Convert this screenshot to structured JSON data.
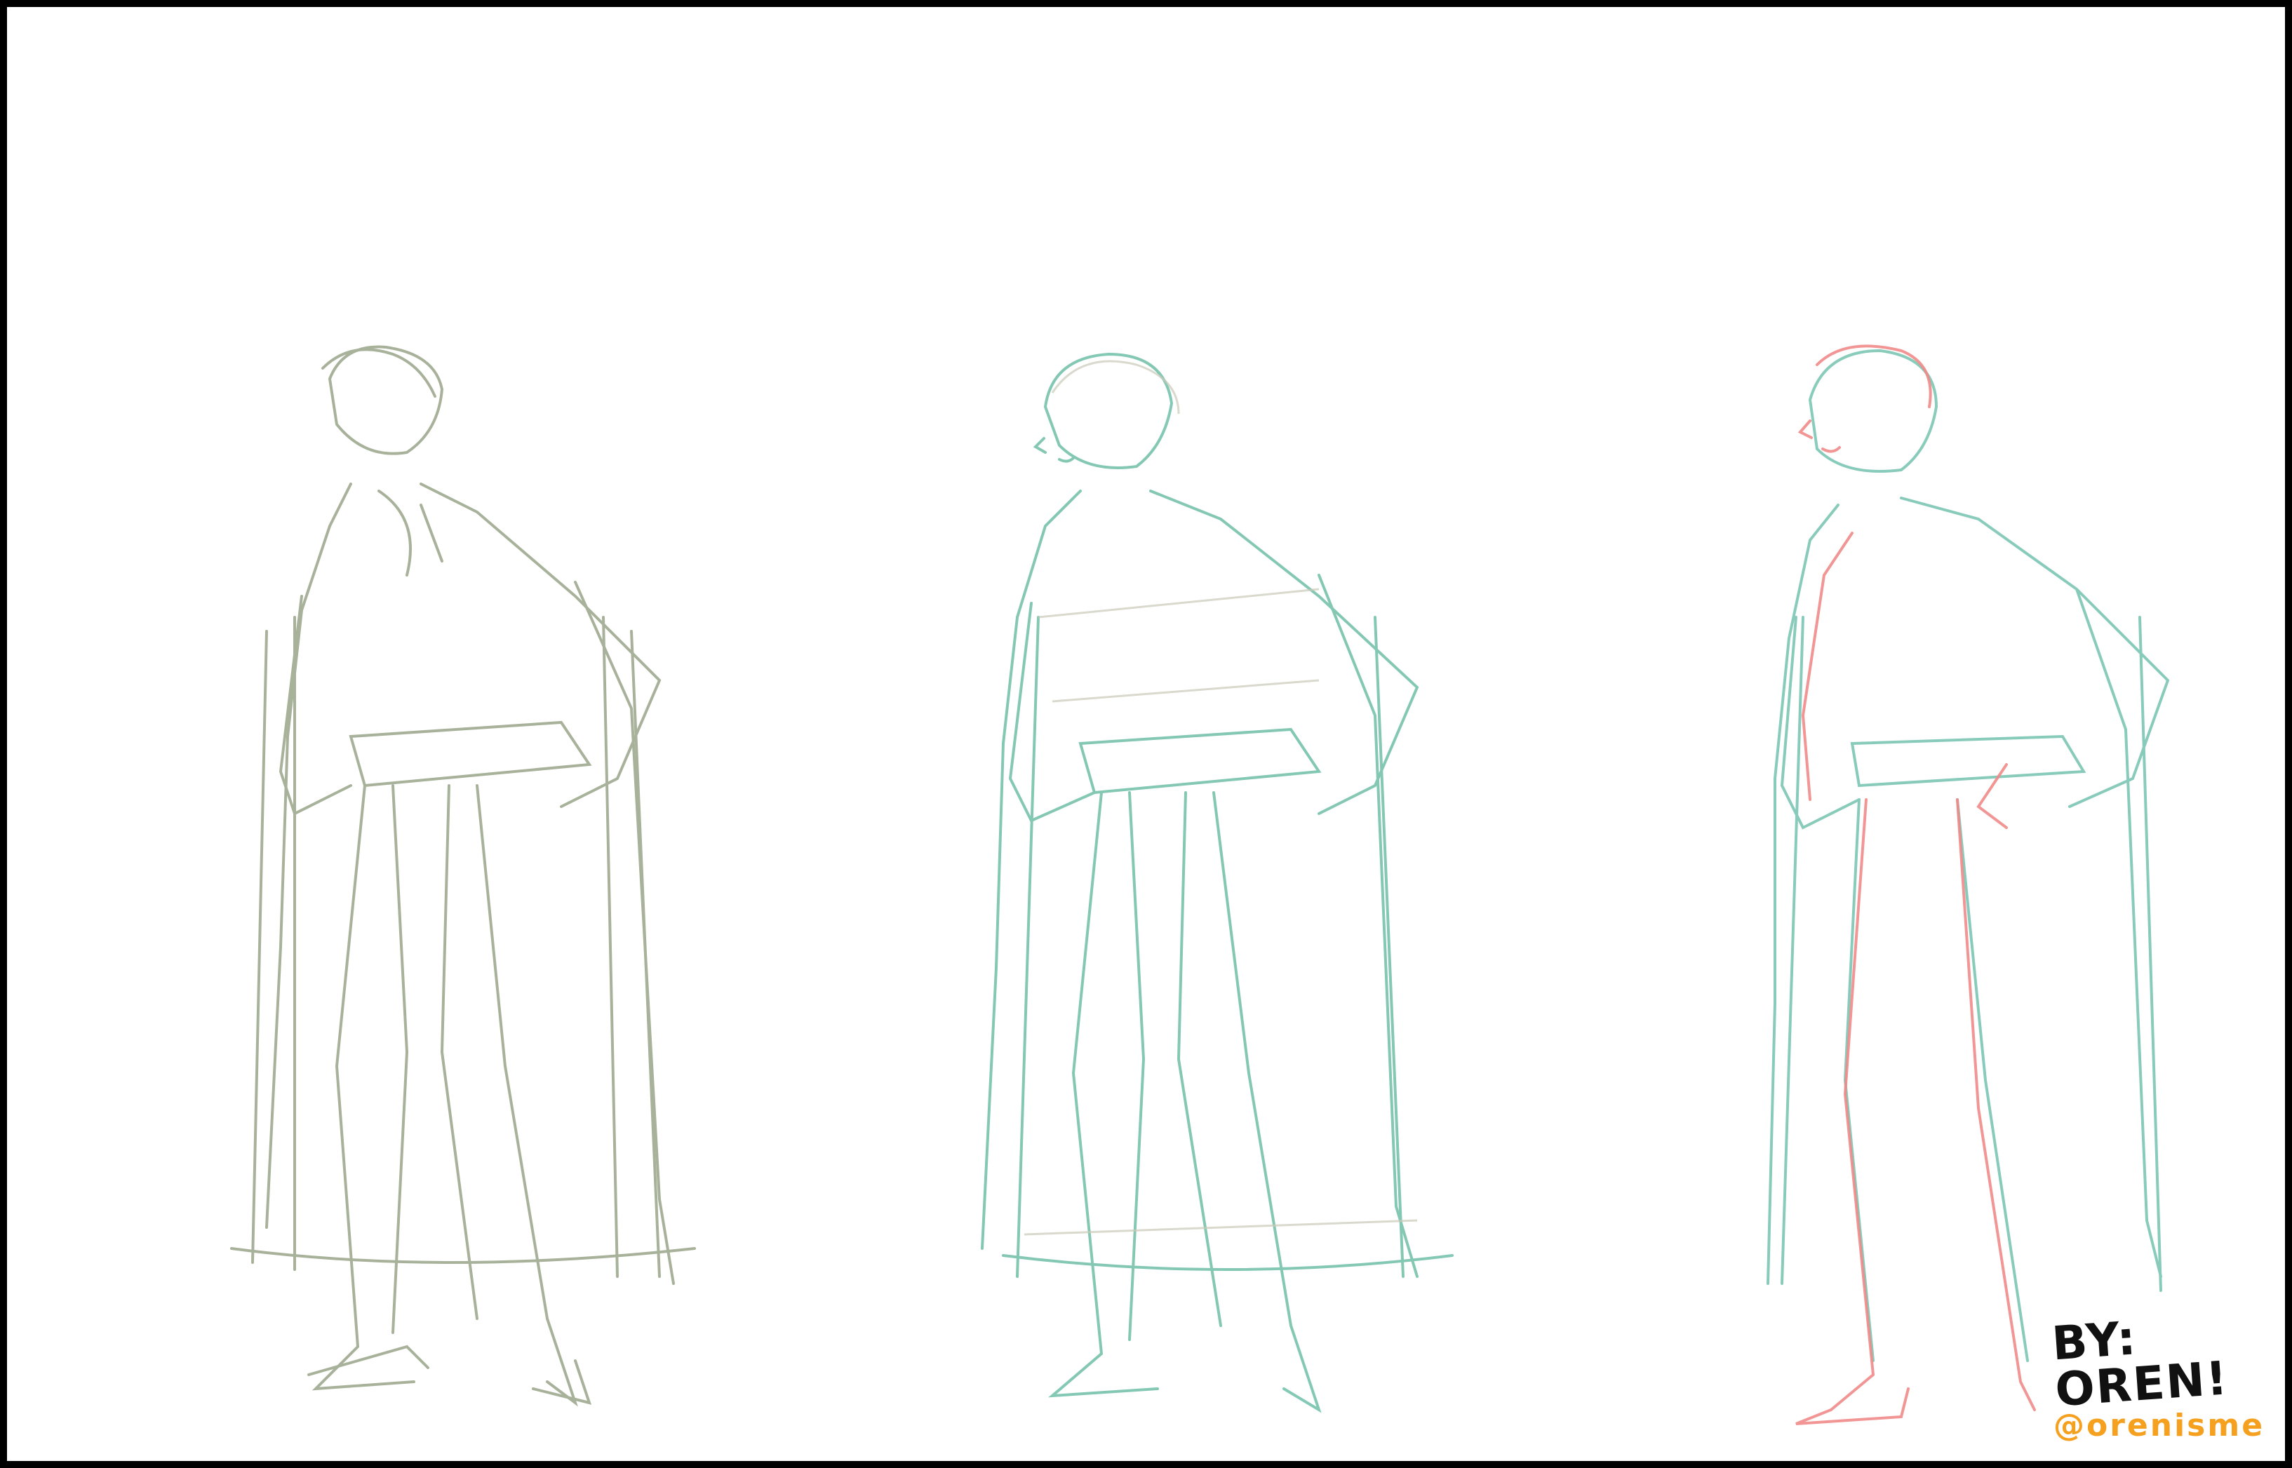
{
  "artwork": {
    "figures": [
      {
        "stage": "rough-sketch",
        "line_color": "#9aa58a"
      },
      {
        "stage": "refined-sketch",
        "line_color": "#6fbfa8"
      },
      {
        "stage": "lineart",
        "line_color": "#7cc6b4",
        "accent_color": "#f08a8a"
      }
    ],
    "background_color": "#ffffff",
    "border_color": "#000000"
  },
  "signature": {
    "name": "BY: OREN!",
    "handle": "@orenisme",
    "name_color": "#111111",
    "handle_color": "#f5a01e"
  }
}
